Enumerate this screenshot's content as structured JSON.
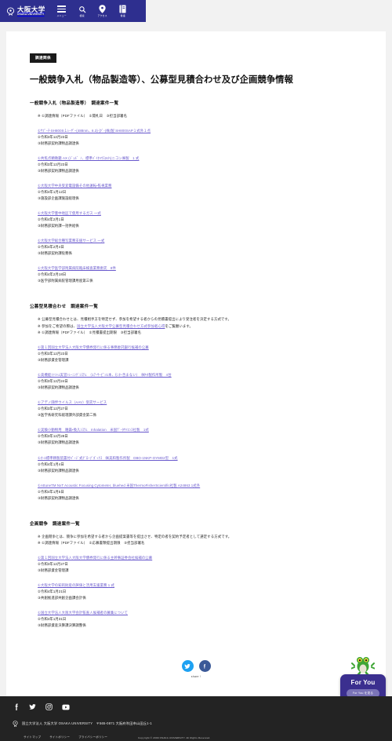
{
  "header": {
    "brand_ja": "大阪大学",
    "brand_en": "OSAKA UNIVERSITY",
    "tools": [
      {
        "label": "メニュー",
        "icon": "hamburger-icon"
      },
      {
        "label": "検索",
        "icon": "search-icon"
      },
      {
        "label": "アクセス",
        "icon": "map-pin-icon"
      },
      {
        "label": "言語",
        "icon": "book-icon"
      }
    ]
  },
  "page": {
    "badge": "調達関係",
    "title": "一般競争入札（物品製造等）、公募型見積合わせ及び企画競争情報"
  },
  "sections": [
    {
      "heading": "一般競争入札（物品製造等）　調達案件一覧",
      "notes": [
        {
          "parts": [
            {
              "text": "※ ①調達情報（PDFファイル）　②開札日　③担当部署名",
              "link": false
            }
          ]
        }
      ],
      "cases": [
        {
          "title": "①ｻﾌﾟｰﾁ-SH800S１ﾚｰｻﾞｰ(488nm、6.3)-]ﾂﾞ-(株)製 SH800SAP１式外１点",
          "date": "②令和3年12月23日",
          "dept": "③財務部契約課物品調達係"
        },
        {
          "title": "①共焦点顕微鏡 AX (ｼﾞｪﾙ゛ﾉ、標準ﾊﾞｲｵﾊｳｽ2ch)ニコン㈱製　1 式",
          "date": "②令和3年12月23日",
          "dept": "③財務部契約課物品調達係"
        },
        {
          "title": "①大阪大学中央受変電設備その他運転・監視業務",
          "date": "②令和4年1月12日",
          "dept": "③施設部企画課施設経理係"
        },
        {
          "title": "①大阪大学豊中地区で使用するガス 一式",
          "date": "②令和4年2月1日",
          "dept": "③財務部契約課一括供給係"
        },
        {
          "title": "①大阪大学総合種写業務支援サービス 一式",
          "date": "②令和4年2月4日",
          "dept": "③財務部契約課役務係"
        },
        {
          "title": "①大阪大学医学部附属病院臨床検査業務委託　8件",
          "date": "②令和4年2月18日",
          "dept": "③医学部附属病院管理課用度第三係"
        }
      ]
    },
    {
      "heading": "公募型見積合わせ　調達案件一覧",
      "notes": [
        {
          "parts": [
            {
              "text": "※ 公募型見積合わせとは、見積相手方を特定せず、参加を希望する者からの見積書提出により受注者を決定する方式です。",
              "link": false
            }
          ]
        },
        {
          "parts": [
            {
              "text": "※ 参加をご希望の際は、",
              "link": false
            },
            {
              "text": "国立大学法人大阪大学公募型見積合わせ方式参加者心得",
              "link": true
            },
            {
              "text": "をご覧願います。",
              "link": false
            }
          ]
        },
        {
          "parts": [
            {
              "text": "※ ①調達情報（PDFファイル）　②見積書提出期限　③担当部署名",
              "link": false
            }
          ]
        }
      ],
      "cases": [
        {
          "title": "①第１回国立大学法人大阪大学債券発行に係る事務委託銀行候補の公募",
          "date": "②令和3年12月23日",
          "dept": "③財務部資金管理課"
        },
        {
          "title": "①高機能ﾌｧﾝﾄﾑ実習ﾄﾚｰﾆﾝｸﾞｼｽﾃﾑ　（1ｱｰｻｰﾋﾟﾝ1本、ﾓﾆﾀｰ含まない）　㈱ｷﾀ製作所製　4台",
          "date": "②令和3年12月24日",
          "dept": "③財務部契約課物品調達係"
        },
        {
          "title": "①アデノ随伴ウイルス（AAV）受託サービス",
          "date": "②令和3年12月27日",
          "dept": "③医学系研究科経理課外部資金第二係"
        },
        {
          "title": "①実験小動物用　睡霧・吸入ｼｽﾃﾑ　Inhalation　米国ﾃﾞｰﾀｻｲｴﾝｽ社製　1式",
          "date": "②令和3年12月28日",
          "dept": "③財務部契約課物品調達係"
        },
        {
          "title": "①ｵｰﾙ標準精製装置付ﾊﾟｰｼﾞ式ｸﾞﾛｰﾌﾞﾎﾞｯｸｽ　㈱美和製作所製　DBO-1NKP-OYMD2型　1式",
          "date": "②令和4年1月4日",
          "dept": "③財務部契約課物品調達係"
        },
        {
          "title": "①AttuneTM NxT Acoustic Focusing Cytometer, bluehed 米国ThermoFisherScientific社製 A24863 1式外",
          "date": "②令和4年1月5日",
          "dept": "③財務部契約課物品調達係"
        }
      ]
    },
    {
      "heading": "企画競争　調達案件一覧",
      "notes": [
        {
          "parts": [
            {
              "text": "※ 企画競争とは、競争に参加を希望する者から企画提案書等を提出させ、特定の者を契約予定者として選定する方式です。",
              "link": false
            }
          ]
        },
        {
          "parts": [
            {
              "text": "※ ①調達情報（PDFファイル）　②応募書類提出期限　③担当部署名",
              "link": false
            }
          ]
        }
      ],
      "cases": [
        {
          "title": "①第１回国立大学法人大阪大学債券発行に係る主幹事証券会社候補の公募",
          "date": "②令和3年12月27日",
          "dept": "③財務部資金管理課"
        },
        {
          "title": "①大阪大学の知的財産の評価と活用支援業務 1 式",
          "date": "②令和4年1月21日",
          "dept": "③共創推進部共創企画課会計係"
        },
        {
          "title": "①国立大学法人大阪大学会計監査人候補者の募集について",
          "date": "②令和4年1月31日",
          "dept": "③財務部資産決算課決算調整係"
        }
      ]
    }
  ],
  "share": {
    "caption": "share !",
    "buttons": [
      {
        "name": "twitter",
        "color": "#1da1f2"
      },
      {
        "name": "facebook",
        "color": "#3b5998"
      }
    ]
  },
  "for_you": {
    "title": "For You",
    "pill": "For You を見る"
  },
  "footer": {
    "social": [
      "facebook-icon",
      "twitter-icon",
      "instagram-icon",
      "youtube-icon"
    ],
    "address": "国立大学法人 大阪大学 OSAKA UNIVERSITY　〒565-0871 大阪府吹田市山田丘1-1",
    "links": [
      "サイトマップ",
      "サイトポリシー",
      "プライバシーポリシー"
    ],
    "copyright": "Copyright © 2009 OSAKA UNIVERSITY. All Rights Reserved."
  },
  "colors": {
    "header_purple": "#2e2f8f",
    "link_purple": "#6a5acd",
    "footer_dark": "#232323",
    "page_bg": "#f2f2f2"
  }
}
